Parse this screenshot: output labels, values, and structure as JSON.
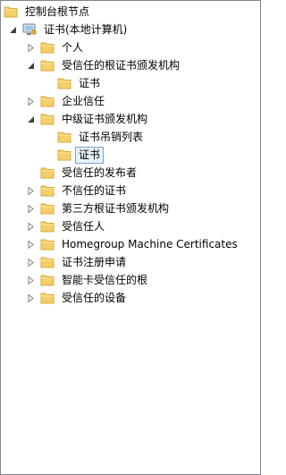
{
  "root": {
    "label": "控制台根节点",
    "icon": "folder-icon"
  },
  "store": {
    "label": "证书(本地计算机)",
    "icon": "computer-certificate-icon",
    "expanded": true
  },
  "tree": [
    {
      "label": "个人",
      "expanded": false,
      "has_children": true
    },
    {
      "label": "受信任的根证书颁发机构",
      "expanded": true,
      "has_children": true,
      "children": [
        {
          "label": "证书"
        }
      ]
    },
    {
      "label": "企业信任",
      "expanded": false,
      "has_children": true
    },
    {
      "label": "中级证书颁发机构",
      "expanded": true,
      "has_children": true,
      "children": [
        {
          "label": "证书吊销列表"
        },
        {
          "label": "证书",
          "selected": true
        }
      ]
    },
    {
      "label": "受信任的发布者",
      "has_children": false
    },
    {
      "label": "不信任的证书",
      "expanded": false,
      "has_children": true
    },
    {
      "label": "第三方根证书颁发机构",
      "expanded": false,
      "has_children": true
    },
    {
      "label": "受信任人",
      "expanded": false,
      "has_children": true
    },
    {
      "label": "Homegroup Machine Certificates",
      "expanded": false,
      "has_children": true
    },
    {
      "label": "证书注册申请",
      "expanded": false,
      "has_children": true
    },
    {
      "label": "智能卡受信任的根",
      "expanded": false,
      "has_children": true
    },
    {
      "label": "受信任的设备",
      "expanded": false,
      "has_children": true
    }
  ],
  "colors": {
    "folder": "#f4cf6a",
    "folder_dark": "#d9a93a",
    "selection_bg": "#e5f3fb",
    "selection_border": "#7da2ce"
  }
}
